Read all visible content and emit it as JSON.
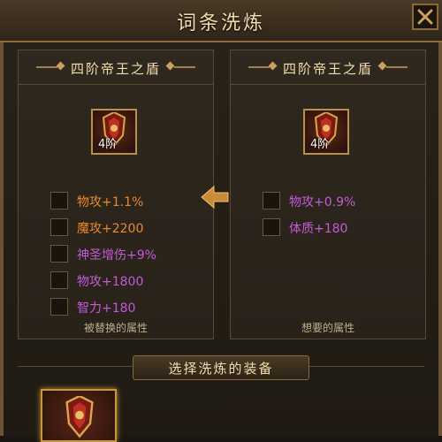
{
  "window": {
    "title": "词条洗炼"
  },
  "left_panel": {
    "item_name": "四阶帝王之盾",
    "tier_label": "4阶",
    "attributes": [
      {
        "text": "物攻+1.1%",
        "color": "#e8892a"
      },
      {
        "text": "魔攻+2200",
        "color": "#e8892a"
      },
      {
        "text": "神圣增伤+9%",
        "color": "#c25bd8"
      },
      {
        "text": "物攻+1800",
        "color": "#c25bd8"
      },
      {
        "text": "智力+180",
        "color": "#c25bd8"
      }
    ],
    "caption": "被替换的属性"
  },
  "right_panel": {
    "item_name": "四阶帝王之盾",
    "tier_label": "4阶",
    "attributes": [
      {
        "text": "物攻+0.9%",
        "color": "#c25bd8"
      },
      {
        "text": "体质+180",
        "color": "#c25bd8"
      }
    ],
    "caption": "想要的属性"
  },
  "select_section": {
    "label": "选择洗炼的装备"
  },
  "icons": {
    "close": "close-icon",
    "transfer_arrow": "arrow-left-icon",
    "item": "shield-icon"
  },
  "colors": {
    "accent": "#c8963c",
    "orange_attr": "#e8892a",
    "purple_attr": "#c25bd8"
  }
}
